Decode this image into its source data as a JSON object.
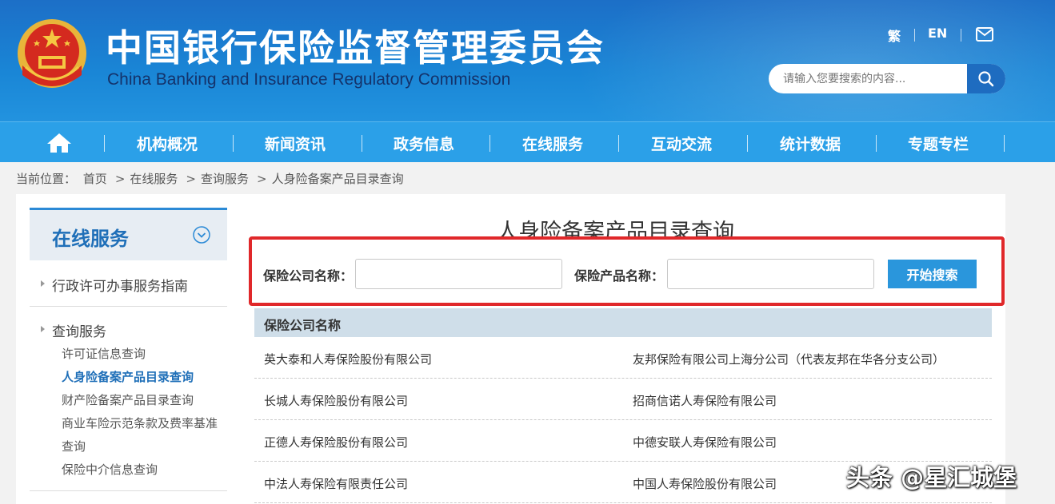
{
  "header": {
    "title_cn": "中国银行保险监督管理委员会",
    "title_en": "China Banking and Insurance Regulatory Commission",
    "lang_traditional": "繁",
    "lang_english": "EN",
    "search_placeholder": "请输入您要搜索的内容..."
  },
  "nav": {
    "items": [
      {
        "label": "机构概况"
      },
      {
        "label": "新闻资讯"
      },
      {
        "label": "政务信息"
      },
      {
        "label": "在线服务"
      },
      {
        "label": "互动交流"
      },
      {
        "label": "统计数据"
      },
      {
        "label": "专题专栏"
      }
    ]
  },
  "breadcrumb": {
    "prefix": "当前位置：",
    "items": [
      "首页",
      "在线服务",
      "查询服务",
      "人身险备案产品目录查询"
    ]
  },
  "sidebar": {
    "title": "在线服务",
    "sections": [
      {
        "label": "行政许可办事服务指南"
      },
      {
        "label": "查询服务"
      }
    ],
    "sub_items": [
      {
        "label": "许可证信息查询"
      },
      {
        "label": "人身险备案产品目录查询"
      },
      {
        "label": "财产险备案产品目录查询"
      },
      {
        "label": "商业车险示范条款及费率基准"
      },
      {
        "label": "查询"
      },
      {
        "label": "保险中介信息查询"
      }
    ]
  },
  "main": {
    "title": "人身险备案产品目录查询",
    "form": {
      "company_label": "保险公司名称：",
      "company_value": "",
      "product_label": "保险产品名称：",
      "product_value": "",
      "search_button": "开始搜索"
    },
    "table": {
      "header": "保险公司名称",
      "rows": [
        [
          "英大泰和人寿保险股份有限公司",
          "友邦保险有限公司上海分公司（代表友邦在华各分支公司）"
        ],
        [
          "长城人寿保险股份有限公司",
          "招商信诺人寿保险有限公司"
        ],
        [
          "正德人寿保险股份有限公司",
          "中德安联人寿保险有限公司"
        ],
        [
          "中法人寿保险有限责任公司",
          "中国人寿保险股份有限公司"
        ]
      ]
    }
  },
  "watermark": "头条 @星汇城堡",
  "colors": {
    "header_blue": "#1a86d6",
    "nav_blue": "#2ba0e8",
    "highlight_red": "#e0282a",
    "button_blue": "#2a96dc",
    "table_head": "#cfdee9"
  }
}
